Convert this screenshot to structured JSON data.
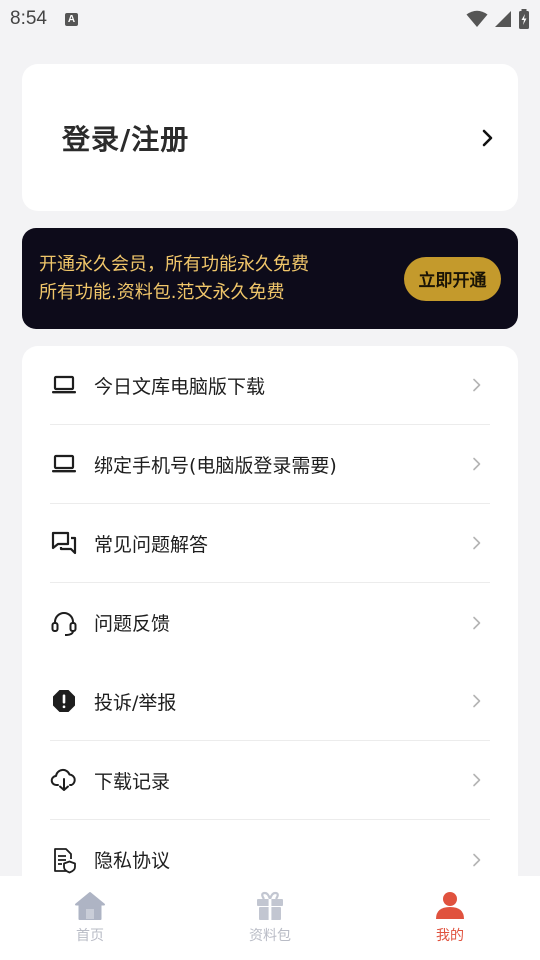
{
  "status_bar": {
    "time": "8:54",
    "notification_badge": "A"
  },
  "login_card": {
    "label": "登录/注册"
  },
  "vip_banner": {
    "line1": "开通永久会员，所有功能永久免费",
    "line2": "所有功能.资料包.范文永久免费",
    "button_label": "立即开通",
    "colors": {
      "background": "#0d0b1a",
      "text": "#f0c66a",
      "button": "#c49a2c"
    }
  },
  "menu": {
    "items": [
      {
        "label": "今日文库电脑版下载",
        "icon": "laptop-icon"
      },
      {
        "label": "绑定手机号(电脑版登录需要)",
        "icon": "laptop-icon"
      },
      {
        "label": "常见问题解答",
        "icon": "chat-bubbles-icon"
      },
      {
        "label": "问题反馈",
        "icon": "headset-icon"
      },
      {
        "label": "投诉/举报",
        "icon": "alert-octagon-icon"
      },
      {
        "label": "下载记录",
        "icon": "cloud-download-icon"
      },
      {
        "label": "隐私协议",
        "icon": "document-shield-icon"
      }
    ]
  },
  "tab_bar": {
    "tabs": [
      {
        "label": "首页",
        "icon": "home-icon",
        "active": false
      },
      {
        "label": "资料包",
        "icon": "gift-icon",
        "active": false
      },
      {
        "label": "我的",
        "icon": "user-icon",
        "active": true
      }
    ],
    "colors": {
      "active": "#e0523e",
      "inactive": "#b9bcc6"
    }
  }
}
